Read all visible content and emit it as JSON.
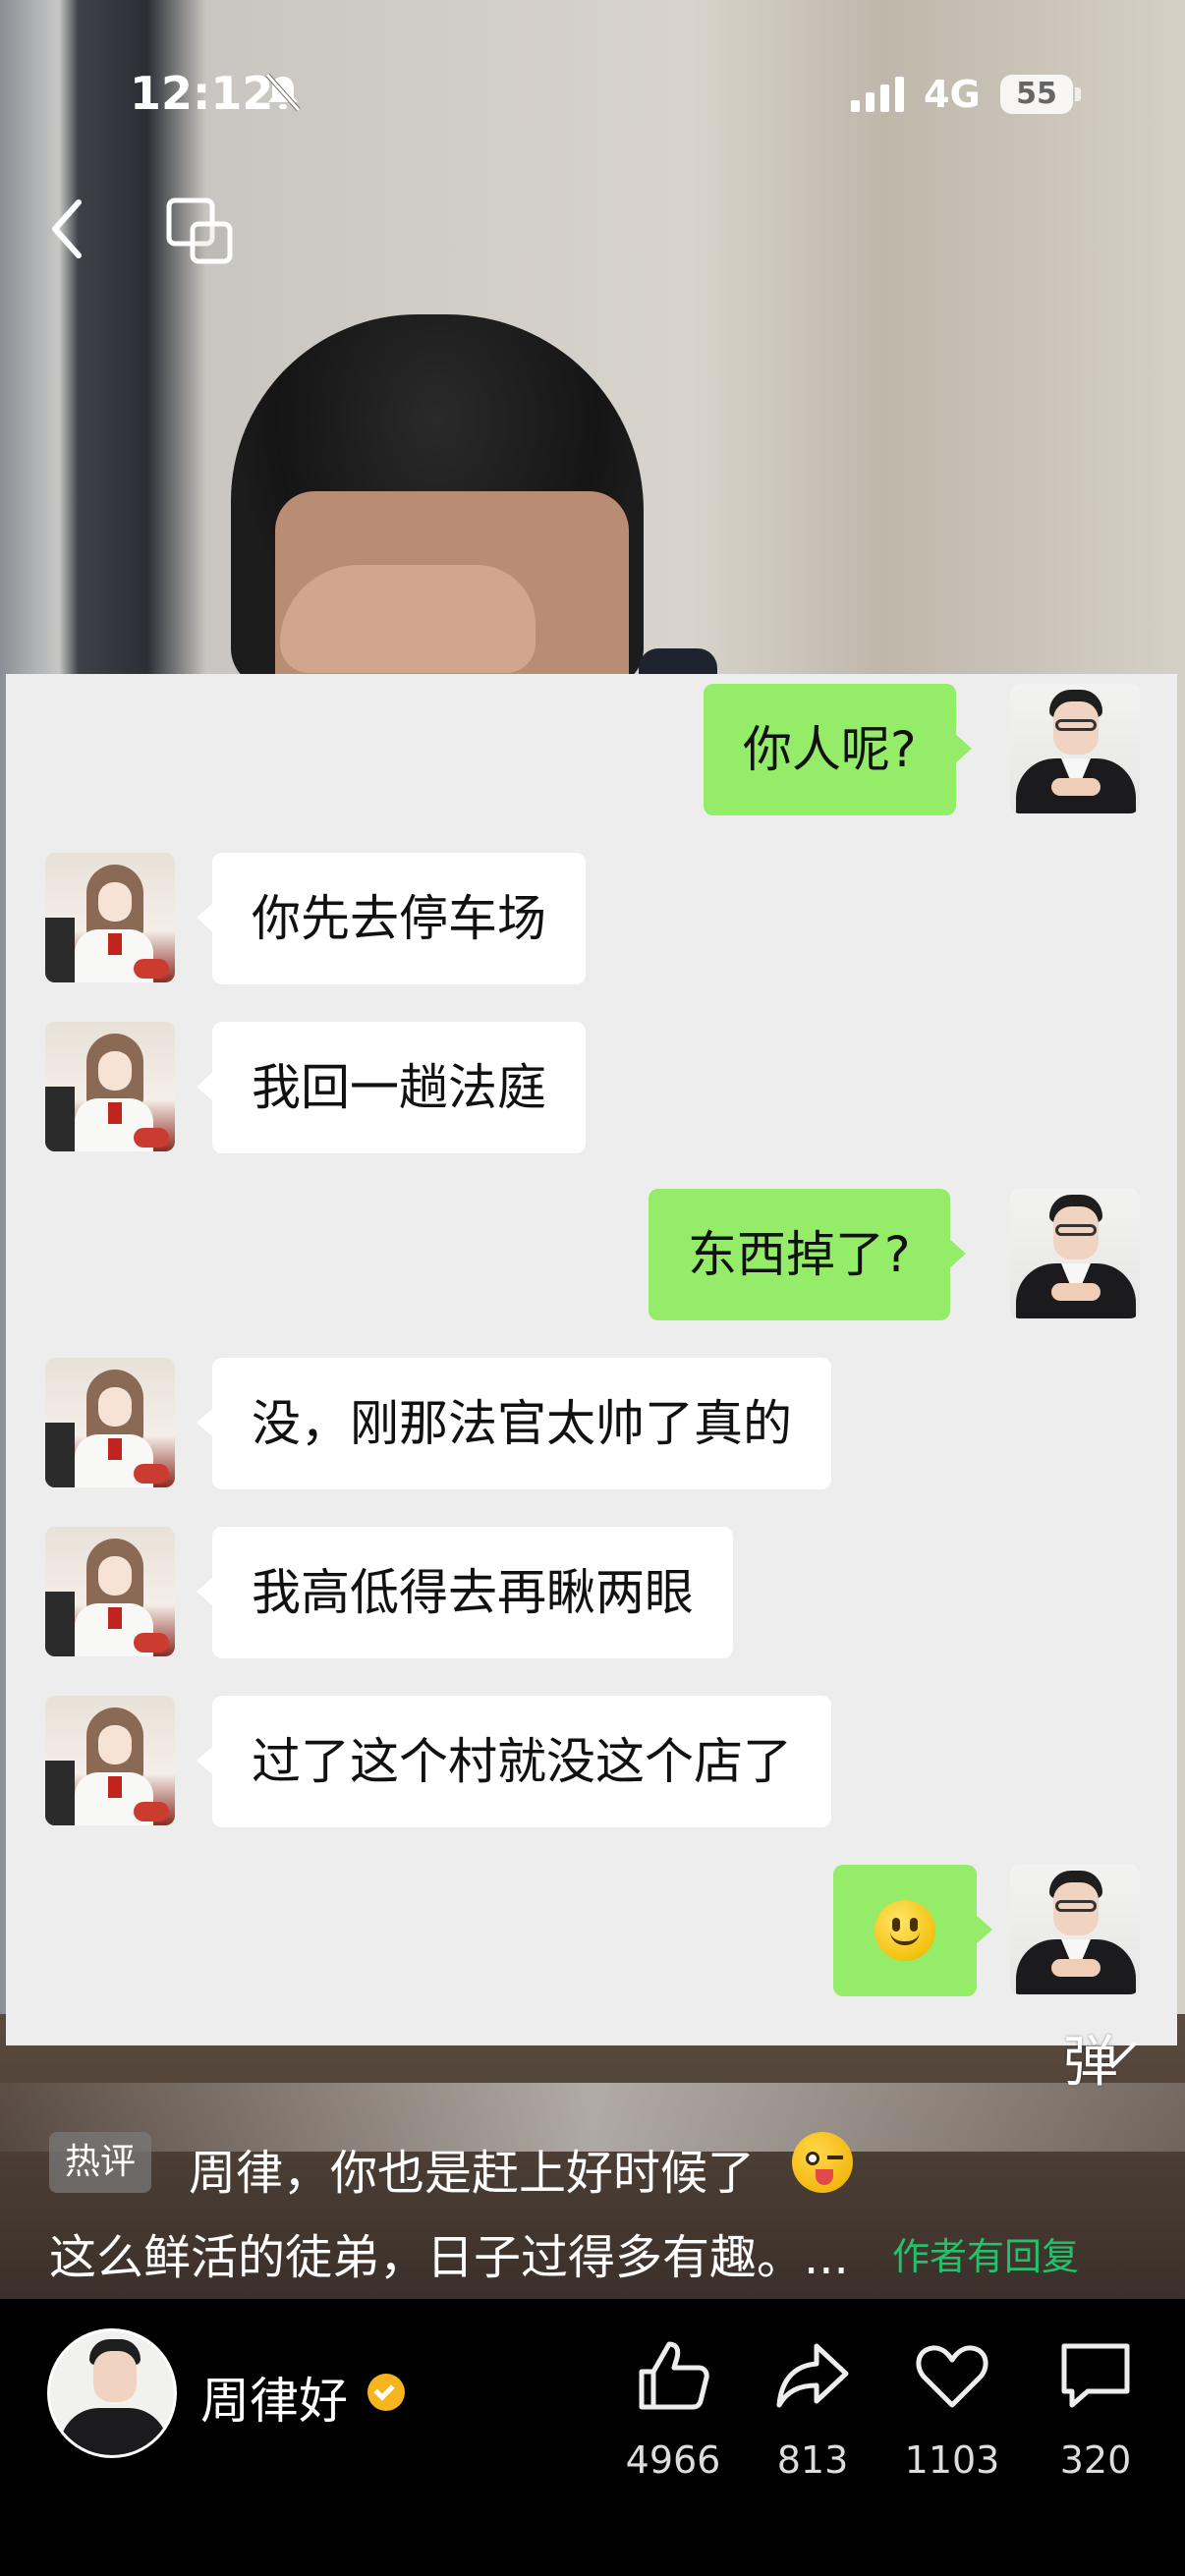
{
  "status_bar": {
    "time": "12:12",
    "network": "4G",
    "battery": "55"
  },
  "chat": {
    "messages": [
      {
        "side": "right",
        "text": "你人呢?"
      },
      {
        "side": "left",
        "text": "你先去停车场"
      },
      {
        "side": "left",
        "text": "我回一趟法庭"
      },
      {
        "side": "right",
        "text": "东西掉了?"
      },
      {
        "side": "left",
        "text": "没，刚那法官太帅了真的"
      },
      {
        "side": "left",
        "text": "我高低得去再瞅两眼"
      },
      {
        "side": "left",
        "text": "过了这个村就没这个店了"
      },
      {
        "side": "right",
        "emoji": "smiley-emoji"
      }
    ]
  },
  "danmaku": {
    "label": "弹"
  },
  "hot_comment": {
    "badge": "热评",
    "line1": "周律，你也是赶上好时候了",
    "line2": "这么鲜活的徒弟，日子过得多有趣。...",
    "reply_link": "作者有回复"
  },
  "author": {
    "name": "周律好"
  },
  "actions": {
    "like_count": "4966",
    "share_count": "813",
    "favorite_count": "1103",
    "comment_count": "320"
  },
  "colors": {
    "green_bubble": "#95ec69",
    "reply_green": "#24c16a",
    "verified_gold": "#f6b51e"
  }
}
